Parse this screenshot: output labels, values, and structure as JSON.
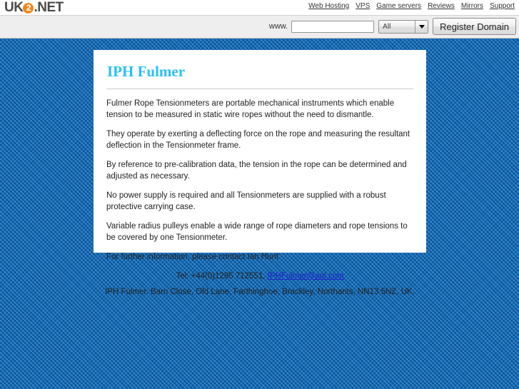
{
  "header": {
    "logo": {
      "prefix": "UK",
      "badge": "2",
      "suffix": ".NET"
    },
    "nav_links": [
      {
        "label": "Web Hosting"
      },
      {
        "label": "VPS"
      },
      {
        "label": "Game servers"
      },
      {
        "label": "Reviews"
      },
      {
        "label": "Mirrors"
      },
      {
        "label": "Support"
      }
    ]
  },
  "search": {
    "www_label": "www.",
    "domain_value": "",
    "domain_placeholder": "",
    "tld_selected": "All",
    "register_label": "Register Domain"
  },
  "main": {
    "title": "IPH Fulmer",
    "paragraphs": [
      "Fulmer Rope Tensionmeters are portable mechanical instruments which enable tension to be measured in static wire ropes without the need to dismantle.",
      "They operate by exerting a deflecting force on the rope and measuring the resultant deflection in the Tensionmeter frame.",
      "By reference to pre-calibration data, the tension in the rope can be determined and adjusted as necessary.",
      "No power supply is required and all Tensionmeters are supplied with a robust protective carrying case.",
      "Variable radius pulleys enable a wide range of rope diameters and rope tensions to be covered by one Tensionmeter.",
      "For further information, please contact Ian Hunt"
    ],
    "tel_prefix": "Tel: +44(0)1295 712551,",
    "email": "IPHFulmer@aol.com",
    "address": "IPH Fulmer. Barn Close, Old Lane, Farthinghoe, Brackley, Northants, NN13 5NZ, UK."
  },
  "colors": {
    "accent_title": "#29c0f5",
    "logo_badge": "#f08a1e",
    "background_blue": "#0f6cbd",
    "link_blue": "#2222cc"
  }
}
